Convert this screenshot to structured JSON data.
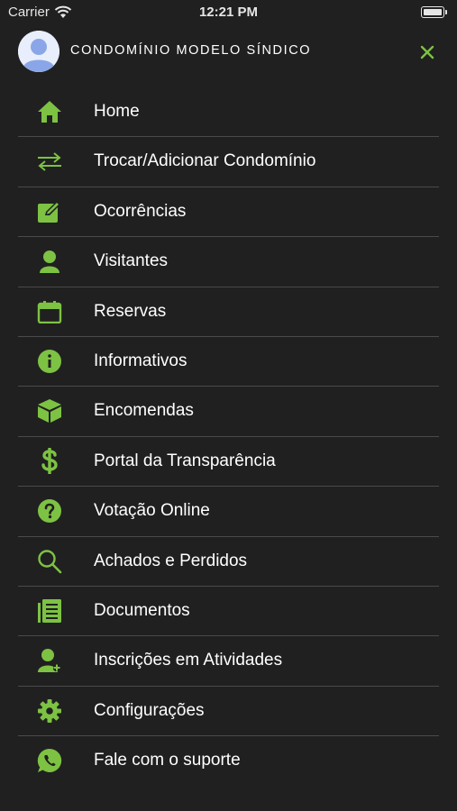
{
  "status_bar": {
    "carrier": "Carrier",
    "time": "12:21 PM",
    "battery": 1.0
  },
  "header": {
    "condo_name": "CONDOMÍNIO MODELO SÍNDICO",
    "close_icon": "close-icon"
  },
  "colors": {
    "accent": "#7dc243",
    "background": "#202020",
    "divider": "#4a4a4a",
    "text": "#ffffff"
  },
  "menu": {
    "items": [
      {
        "label": "Home",
        "icon": "home-icon"
      },
      {
        "label": "Trocar/Adicionar Condomínio",
        "icon": "swap-arrows-icon"
      },
      {
        "label": "Ocorrências",
        "icon": "edit-note-icon"
      },
      {
        "label": "Visitantes",
        "icon": "person-icon"
      },
      {
        "label": "Reservas",
        "icon": "calendar-icon"
      },
      {
        "label": "Informativos",
        "icon": "info-icon"
      },
      {
        "label": "Encomendas",
        "icon": "package-icon"
      },
      {
        "label": "Portal da Transparência",
        "icon": "dollar-icon"
      },
      {
        "label": "Votação Online",
        "icon": "help-icon"
      },
      {
        "label": "Achados e Perdidos",
        "icon": "search-icon"
      },
      {
        "label": "Documentos",
        "icon": "documents-icon"
      },
      {
        "label": "Inscrições em Atividades",
        "icon": "person-add-icon"
      },
      {
        "label": "Configurações",
        "icon": "gear-icon"
      },
      {
        "label": "Fale com o suporte",
        "icon": "whatsapp-icon"
      }
    ]
  }
}
